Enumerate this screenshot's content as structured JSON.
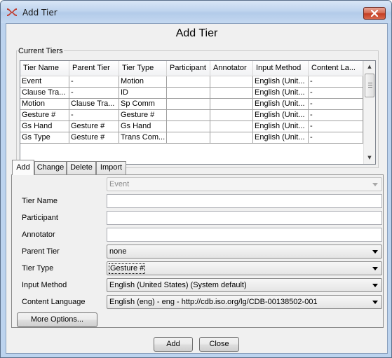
{
  "window": {
    "title": "Add Tier"
  },
  "dialog": {
    "heading": "Add Tier"
  },
  "current_tiers": {
    "label": "Current Tiers",
    "columns": [
      "Tier Name",
      "Parent Tier",
      "Tier Type",
      "Participant",
      "Annotator",
      "Input Method",
      "Content La..."
    ],
    "rows": [
      [
        "Event",
        "-",
        "Motion",
        "",
        "",
        "English (Unit...",
        "-"
      ],
      [
        "Clause Tra...",
        "-",
        "ID",
        "",
        "",
        "English (Unit...",
        "-"
      ],
      [
        "Motion",
        "Clause Tra...",
        "Sp Comm",
        "",
        "",
        "English (Unit...",
        "-"
      ],
      [
        "Gesture #",
        "-",
        "Gesture #",
        "",
        "",
        "English (Unit...",
        "-"
      ],
      [
        "Gs Hand",
        "Gesture #",
        "Gs Hand",
        "",
        "",
        "English (Unit...",
        "-"
      ],
      [
        "Gs Type",
        "Gesture #",
        "Trans Com...",
        "",
        "",
        "English (Unit...",
        "-"
      ]
    ]
  },
  "tabs": [
    "Add",
    "Change",
    "Delete",
    "Import"
  ],
  "form": {
    "tier_selector": {
      "value": "Event",
      "enabled": false
    },
    "tier_name": {
      "label": "Tier Name",
      "value": ""
    },
    "participant": {
      "label": "Participant",
      "value": ""
    },
    "annotator": {
      "label": "Annotator",
      "value": ""
    },
    "parent_tier": {
      "label": "Parent Tier",
      "value": "none"
    },
    "tier_type": {
      "label": "Tier Type",
      "value": "Gesture #"
    },
    "input_method": {
      "label": "Input Method",
      "value": "English (United States) (System default)"
    },
    "content_language": {
      "label": "Content Language",
      "value": "English (eng) - eng - http://cdb.iso.org/lg/CDB-00138502-001"
    },
    "more_options_label": "More Options..."
  },
  "buttons": {
    "add": "Add",
    "close": "Close"
  },
  "icons": {
    "app": "elan-app-icon",
    "close": "close-icon"
  },
  "colors": {
    "title_bar": "#bcd3ee",
    "close_button": "#c43c22",
    "background": "#f0f0f0"
  }
}
